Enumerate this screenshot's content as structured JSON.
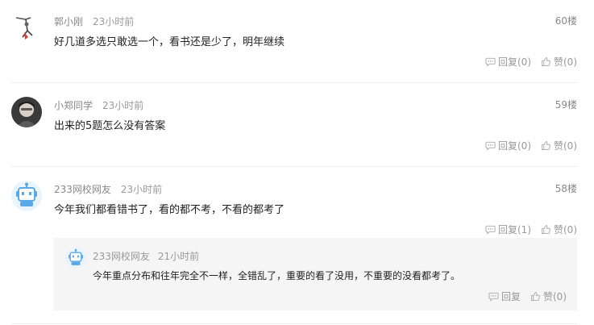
{
  "comments": [
    {
      "username": "郭小刚",
      "time": "23小时前",
      "floor": "60楼",
      "text": "好几道多选只敢选一个，看书还是少了，明年继续",
      "reply_label": "回复(0)",
      "like_label": "赞(0)"
    },
    {
      "username": "小郑同学",
      "time": "23小时前",
      "floor": "59楼",
      "text": "出来的5题怎么没有答案",
      "reply_label": "回复(0)",
      "like_label": "赞(0)"
    },
    {
      "username": "233网校网友",
      "time": "23小时前",
      "floor": "58楼",
      "text": "今年我们都看错书了，看的都不考，不看的都考了",
      "reply_label": "回复(1)",
      "like_label": "赞(0)",
      "replies": [
        {
          "username": "233网校网友",
          "time": "21小时前",
          "text": "今年重点分布和往年完全不一样，全错乱了，重要的看了没用，不重要的没看都考了。",
          "reply_label": "回复",
          "like_label": "赞(0)"
        }
      ]
    }
  ],
  "colors": {
    "muted_text": "#999999",
    "body_text": "#222222",
    "reply_bg": "#f5f5f5",
    "divider": "#eeeeee",
    "robot_blue": "#5aa9e6"
  },
  "icons": {
    "reply": "comment-bubble-icon",
    "like": "thumbs-up-icon"
  }
}
